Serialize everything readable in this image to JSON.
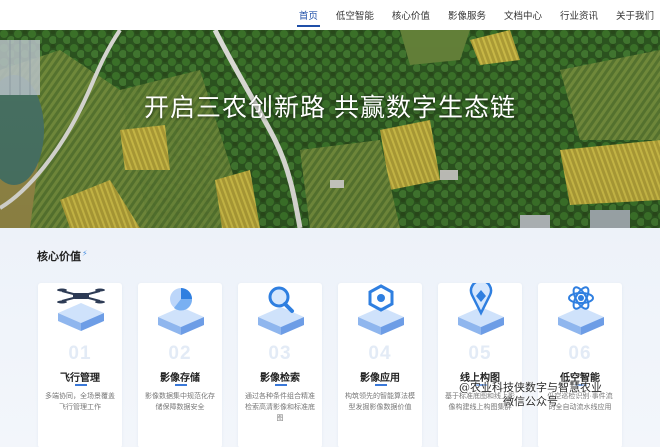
{
  "nav": {
    "items": [
      {
        "label": "首页",
        "active": true
      },
      {
        "label": "低空智能",
        "active": false
      },
      {
        "label": "核心价值",
        "active": false
      },
      {
        "label": "影像服务",
        "active": false
      },
      {
        "label": "文档中心",
        "active": false
      },
      {
        "label": "行业资讯",
        "active": false
      },
      {
        "label": "关于我们",
        "active": false
      }
    ]
  },
  "hero": {
    "title": "开启三农创新路 共赢数字生态链"
  },
  "core": {
    "title": "核心价值",
    "cards": [
      {
        "num": "01",
        "title": "飞行管理",
        "desc": "多端协同，全场景覆盖飞行管理工作",
        "icon": "drone-icon"
      },
      {
        "num": "02",
        "title": "影像存储",
        "desc": "影像数据集中规范化存储保障数据安全",
        "icon": "pie-chart-icon"
      },
      {
        "num": "03",
        "title": "影像检索",
        "desc": "通过各种条件组合精准检索高清影像和标准底图",
        "icon": "magnifier-icon"
      },
      {
        "num": "04",
        "title": "影像应用",
        "desc": "构筑领先的智能算法模型发掘影像数据价值",
        "icon": "cube-network-icon"
      },
      {
        "num": "05",
        "title": "线上构图",
        "desc": "基于标准底图和线上影像构建线上构图集群",
        "icon": "map-pin-icon"
      },
      {
        "num": "06",
        "title": "低空智能",
        "desc": "低空巡检识别·事件流的全自动流水线应用",
        "icon": "atom-icon"
      }
    ]
  },
  "watermark": {
    "line1": "@农业科技侠数字与智慧农业",
    "line2": "微信公众号"
  }
}
